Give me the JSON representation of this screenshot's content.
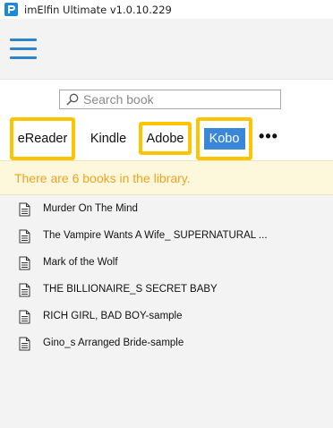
{
  "app": {
    "title": "imElfin Ultimate v1.0.10.229"
  },
  "header": {
    "menu_icon": "hamburger-menu-icon",
    "accent_color": "#2d84c9"
  },
  "search": {
    "placeholder": "Search book",
    "value": ""
  },
  "tabs": [
    {
      "label": "eReader",
      "highlighted": true,
      "selected": false
    },
    {
      "label": "Kindle",
      "highlighted": false,
      "selected": false
    },
    {
      "label": "Adobe",
      "highlighted": true,
      "selected": false
    },
    {
      "label": "Kobo",
      "highlighted": true,
      "selected": true
    },
    {
      "label": "•••",
      "highlighted": false,
      "selected": false
    }
  ],
  "banner": {
    "text": "There are 6 books in the library.",
    "color": "#f0a321"
  },
  "books": [
    {
      "title": "Murder On The Mind"
    },
    {
      "title": "The Vampire Wants A Wife_ SUPERNATURAL ..."
    },
    {
      "title": "Mark of the Wolf"
    },
    {
      "title": "THE BILLIONAIRE_S SECRET BABY"
    },
    {
      "title": "RICH GIRL, BAD BOY-sample"
    },
    {
      "title": "Gino_s Arranged Bride-sample"
    }
  ],
  "colors": {
    "highlight_border": "#ffc400",
    "selected_tab_bg": "#3a86d8"
  }
}
